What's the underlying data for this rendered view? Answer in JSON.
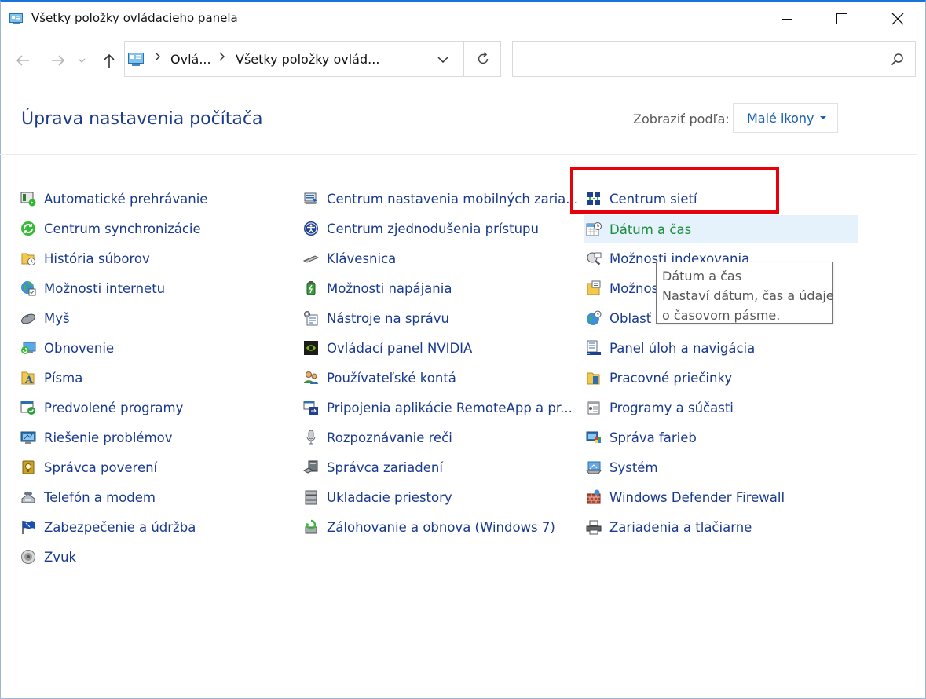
{
  "window": {
    "title": "Všetky položky ovládacieho panela"
  },
  "address": {
    "crumbs": [
      "Ovlá...",
      "Všetky položky ovlád..."
    ],
    "search_placeholder": ""
  },
  "header": {
    "title": "Úprava nastavenia počítača",
    "view_by_label": "Zobraziť podľa:",
    "view_by_value": "Malé ikony"
  },
  "columns": [
    {
      "items": [
        {
          "label": "Automatické prehrávanie",
          "icon": "autoplay-icon"
        },
        {
          "label": "Centrum synchronizácie",
          "icon": "sync-center-icon"
        },
        {
          "label": "História súborov",
          "icon": "file-history-icon"
        },
        {
          "label": "Možnosti internetu",
          "icon": "internet-options-icon"
        },
        {
          "label": "Myš",
          "icon": "mouse-icon"
        },
        {
          "label": "Obnovenie",
          "icon": "recovery-icon"
        },
        {
          "label": "Písma",
          "icon": "fonts-icon"
        },
        {
          "label": "Predvolené programy",
          "icon": "default-programs-icon"
        },
        {
          "label": "Riešenie problémov",
          "icon": "troubleshooting-icon"
        },
        {
          "label": "Správca poverení",
          "icon": "credential-manager-icon"
        },
        {
          "label": "Telefón a modem",
          "icon": "phone-modem-icon"
        },
        {
          "label": "Zabezpečenie a údržba",
          "icon": "security-maintenance-icon"
        },
        {
          "label": "Zvuk",
          "icon": "sound-icon"
        }
      ]
    },
    {
      "items": [
        {
          "label": "Centrum nastavenia mobilných zaria...",
          "icon": "mobility-center-icon"
        },
        {
          "label": "Centrum zjednodušenia prístupu",
          "icon": "ease-of-access-icon"
        },
        {
          "label": "Klávesnica",
          "icon": "keyboard-icon"
        },
        {
          "label": "Možnosti napájania",
          "icon": "power-options-icon"
        },
        {
          "label": "Nástroje na správu",
          "icon": "admin-tools-icon"
        },
        {
          "label": "Ovládací panel NVIDIA",
          "icon": "nvidia-icon"
        },
        {
          "label": "Používateľské kontá",
          "icon": "user-accounts-icon"
        },
        {
          "label": "Pripojenia aplikácie RemoteApp a pr...",
          "icon": "remoteapp-icon"
        },
        {
          "label": "Rozpoznávanie reči",
          "icon": "speech-recognition-icon"
        },
        {
          "label": "Správca zariadení",
          "icon": "device-manager-icon"
        },
        {
          "label": "Ukladacie priestory",
          "icon": "storage-spaces-icon"
        },
        {
          "label": "Zálohovanie a obnova (Windows 7)",
          "icon": "backup-restore-icon"
        }
      ]
    },
    {
      "items": [
        {
          "label": "Centrum sietí",
          "icon": "network-center-icon"
        },
        {
          "label": "Dátum a čas",
          "icon": "date-time-icon"
        },
        {
          "label": "Možnosti indexovania",
          "icon": "indexing-options-icon"
        },
        {
          "label": "Možnos",
          "icon": "folder-options-icon"
        },
        {
          "label": "Oblasť",
          "icon": "region-icon"
        },
        {
          "label": "Panel úloh a navigácia",
          "icon": "taskbar-icon"
        },
        {
          "label": "Pracovné priečinky",
          "icon": "work-folders-icon"
        },
        {
          "label": "Programy a súčasti",
          "icon": "programs-features-icon"
        },
        {
          "label": "Správa farieb",
          "icon": "color-management-icon"
        },
        {
          "label": "Systém",
          "icon": "system-icon"
        },
        {
          "label": "Windows Defender Firewall",
          "icon": "firewall-icon"
        },
        {
          "label": "Zariadenia a tlačiarne",
          "icon": "devices-printers-icon"
        }
      ]
    }
  ],
  "tooltip": {
    "title": "Dátum a čas",
    "line1": "Nastaví dátum, čas a údaje",
    "line2": "o časovom pásme."
  },
  "colors": {
    "link": "#1a3a8f",
    "hover_link": "#1b8d3f",
    "hover_bg": "#e5f1fb",
    "title": "#1c3c8c",
    "highlight": "#e8000b"
  }
}
